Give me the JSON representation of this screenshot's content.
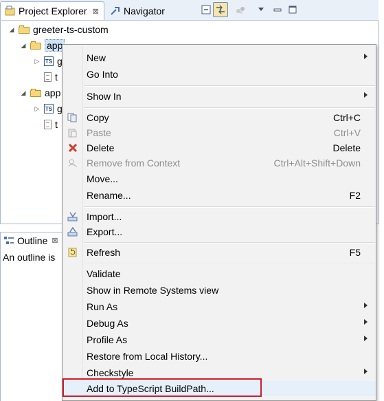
{
  "explorer": {
    "tabs": [
      {
        "label": "Project Explorer",
        "close": "⊠"
      },
      {
        "label": "Navigator"
      }
    ],
    "tree": {
      "project": "greeter-ts-custom",
      "folder1": "app",
      "folder1_ts": "g",
      "folder1_file": "t",
      "folder2": "app",
      "folder2_ts": "g",
      "folder2_file": "t",
      "ts_badge": "TS"
    }
  },
  "outline": {
    "tab_label": "Outline",
    "close": "⊠",
    "message": "An outline is"
  },
  "context_menu": {
    "items": [
      {
        "label": "New",
        "submenu": true
      },
      {
        "label": "Go Into"
      },
      {
        "label": "Show In",
        "submenu": true
      },
      {
        "label": "Copy",
        "shortcut": "Ctrl+C",
        "icon": "copy-icon"
      },
      {
        "label": "Paste",
        "shortcut": "Ctrl+V",
        "icon": "paste-icon",
        "disabled": true
      },
      {
        "label": "Delete",
        "shortcut": "Delete",
        "icon": "delete-icon"
      },
      {
        "label": "Remove from Context",
        "shortcut": "Ctrl+Alt+Shift+Down",
        "icon": "remove-context-icon",
        "disabled": true
      },
      {
        "label": "Move..."
      },
      {
        "label": "Rename...",
        "shortcut": "F2"
      },
      {
        "label": "Import...",
        "icon": "import-icon"
      },
      {
        "label": "Export...",
        "icon": "export-icon"
      },
      {
        "label": "Refresh",
        "shortcut": "F5",
        "icon": "refresh-icon"
      },
      {
        "label": "Validate"
      },
      {
        "label": "Show in Remote Systems view"
      },
      {
        "label": "Run As",
        "submenu": true
      },
      {
        "label": "Debug As",
        "submenu": true
      },
      {
        "label": "Profile As",
        "submenu": true
      },
      {
        "label": "Restore from Local History..."
      },
      {
        "label": "Checkstyle",
        "submenu": true
      },
      {
        "label": "Add to TypeScript BuildPath...",
        "highlighted": true
      }
    ]
  },
  "colors": {
    "highlight_box": "#d11d2c",
    "menu_bg": "#f2f2f2",
    "tab_bar_bg": "#eaf0f8"
  }
}
